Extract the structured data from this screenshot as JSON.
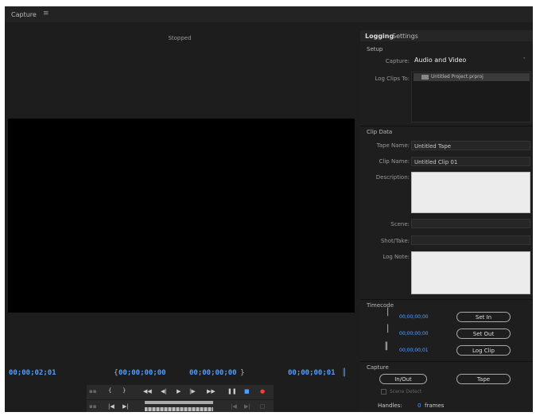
{
  "window": {
    "title": "Capture",
    "menu_icon": "hamburger-icon"
  },
  "monitor": {
    "status": "Stopped"
  },
  "tabs": [
    {
      "label": "Logging",
      "active": true
    },
    {
      "label": "Settings",
      "active": false
    }
  ],
  "setup": {
    "section_label": "Setup",
    "capture_label": "Capture:",
    "capture_value": "Audio and Video",
    "log_clips_label": "Log Clips To:",
    "log_clips_item": "Untitled Project.prproj"
  },
  "clip_data": {
    "section_label": "Clip Data",
    "tape_name_label": "Tape Name:",
    "tape_name_value": "Untitled Tape",
    "clip_name_label": "Clip Name:",
    "clip_name_value": "Untitled Clip 01",
    "description_label": "Description:",
    "scene_label": "Scene:",
    "shot_take_label": "Shot/Take:",
    "log_note_label": "Log Note:"
  },
  "timecode": {
    "section_label": "Timecode",
    "in_value": "00;00;00;00",
    "out_value": "00;00;00;00",
    "duration_value": "00;00;00;01",
    "set_in_label": "Set In",
    "set_out_label": "Set Out",
    "log_clip_label": "Log Clip"
  },
  "capture": {
    "section_label": "Capture",
    "in_out_label": "In/Out",
    "tape_label": "Tape",
    "scene_detect_label": "Scene Detect",
    "handles_label": "Handles:",
    "handles_value": "0",
    "handles_unit": "frames"
  },
  "transport": {
    "current_tc": "00;00;02;01",
    "in_tc": "00;00;00;00",
    "out_tc": "00;00;00;00",
    "duration_tc": "00;00;00;01"
  },
  "colors": {
    "accent": "#4f9dff",
    "record": "#ff3b30",
    "background": "#1d1d1d"
  }
}
